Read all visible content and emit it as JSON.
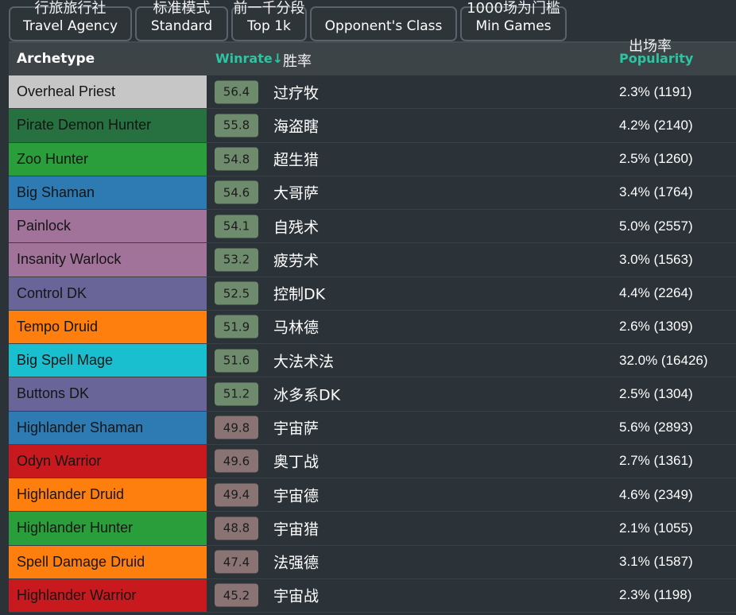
{
  "filters": [
    {
      "zh": "行旅旅行社",
      "en": "Travel Agency"
    },
    {
      "zh": "标准模式",
      "en": "Standard"
    },
    {
      "zh": "前一千分段",
      "en": "Top 1k"
    },
    {
      "zh": "",
      "en": "Opponent's Class"
    },
    {
      "zh": "1000场为门槛",
      "en": "Min Games"
    }
  ],
  "header": {
    "archetype": "Archetype",
    "winrate": "Winrate↓",
    "winrate_zh": "胜率",
    "popularity_zh": "出场率",
    "popularity": "Popularity"
  },
  "colors": {
    "accent": "#2ec4a1",
    "winrate_high": "#6e8b6d",
    "winrate_low": "#8a7373"
  },
  "rows": [
    {
      "name": "Overheal Priest",
      "zh": "过疗牧",
      "winrate": "56.4",
      "popularity": "2.3% (1191)",
      "class_color": "#c6c6c6"
    },
    {
      "name": "Pirate Demon Hunter",
      "zh": "海盗瞎",
      "winrate": "55.8",
      "popularity": "4.2% (2140)",
      "class_color": "#27703f"
    },
    {
      "name": "Zoo Hunter",
      "zh": "超生猎",
      "winrate": "54.8",
      "popularity": "2.5% (1260)",
      "class_color": "#2a9e3a"
    },
    {
      "name": "Big Shaman",
      "zh": "大哥萨",
      "winrate": "54.6",
      "popularity": "3.4% (1764)",
      "class_color": "#2e7bb4"
    },
    {
      "name": "Painlock",
      "zh": "自残术",
      "winrate": "54.1",
      "popularity": "5.0% (2557)",
      "class_color": "#a1739a"
    },
    {
      "name": "Insanity Warlock",
      "zh": "疲劳术",
      "winrate": "53.2",
      "popularity": "3.0% (1563)",
      "class_color": "#a1739a"
    },
    {
      "name": "Control DK",
      "zh": "控制DK",
      "winrate": "52.5",
      "popularity": "4.4% (2264)",
      "class_color": "#6a6598"
    },
    {
      "name": "Tempo Druid",
      "zh": "马林德",
      "winrate": "51.9",
      "popularity": "2.6% (1309)",
      "class_color": "#ff7f0e"
    },
    {
      "name": "Big Spell Mage",
      "zh": "大法术法",
      "winrate": "51.6",
      "popularity": "32.0% (16426)",
      "class_color": "#19bfcf"
    },
    {
      "name": "Buttons DK",
      "zh": "冰多系DK",
      "winrate": "51.2",
      "popularity": "2.5% (1304)",
      "class_color": "#6a6598"
    },
    {
      "name": "Highlander Shaman",
      "zh": "宇宙萨",
      "winrate": "49.8",
      "popularity": "5.6% (2893)",
      "class_color": "#2e7bb4"
    },
    {
      "name": "Odyn Warrior",
      "zh": "奥丁战",
      "winrate": "49.6",
      "popularity": "2.7% (1361)",
      "class_color": "#c8191e"
    },
    {
      "name": "Highlander Druid",
      "zh": "宇宙德",
      "winrate": "49.4",
      "popularity": "4.6% (2349)",
      "class_color": "#ff7f0e"
    },
    {
      "name": "Highlander Hunter",
      "zh": "宇宙猎",
      "winrate": "48.8",
      "popularity": "2.1% (1055)",
      "class_color": "#2a9e3a"
    },
    {
      "name": "Spell Damage Druid",
      "zh": "法强德",
      "winrate": "47.4",
      "popularity": "3.1% (1587)",
      "class_color": "#ff7f0e"
    },
    {
      "name": "Highlander Warrior",
      "zh": "宇宙战",
      "winrate": "45.2",
      "popularity": "2.3% (1198)",
      "class_color": "#c8191e"
    }
  ]
}
